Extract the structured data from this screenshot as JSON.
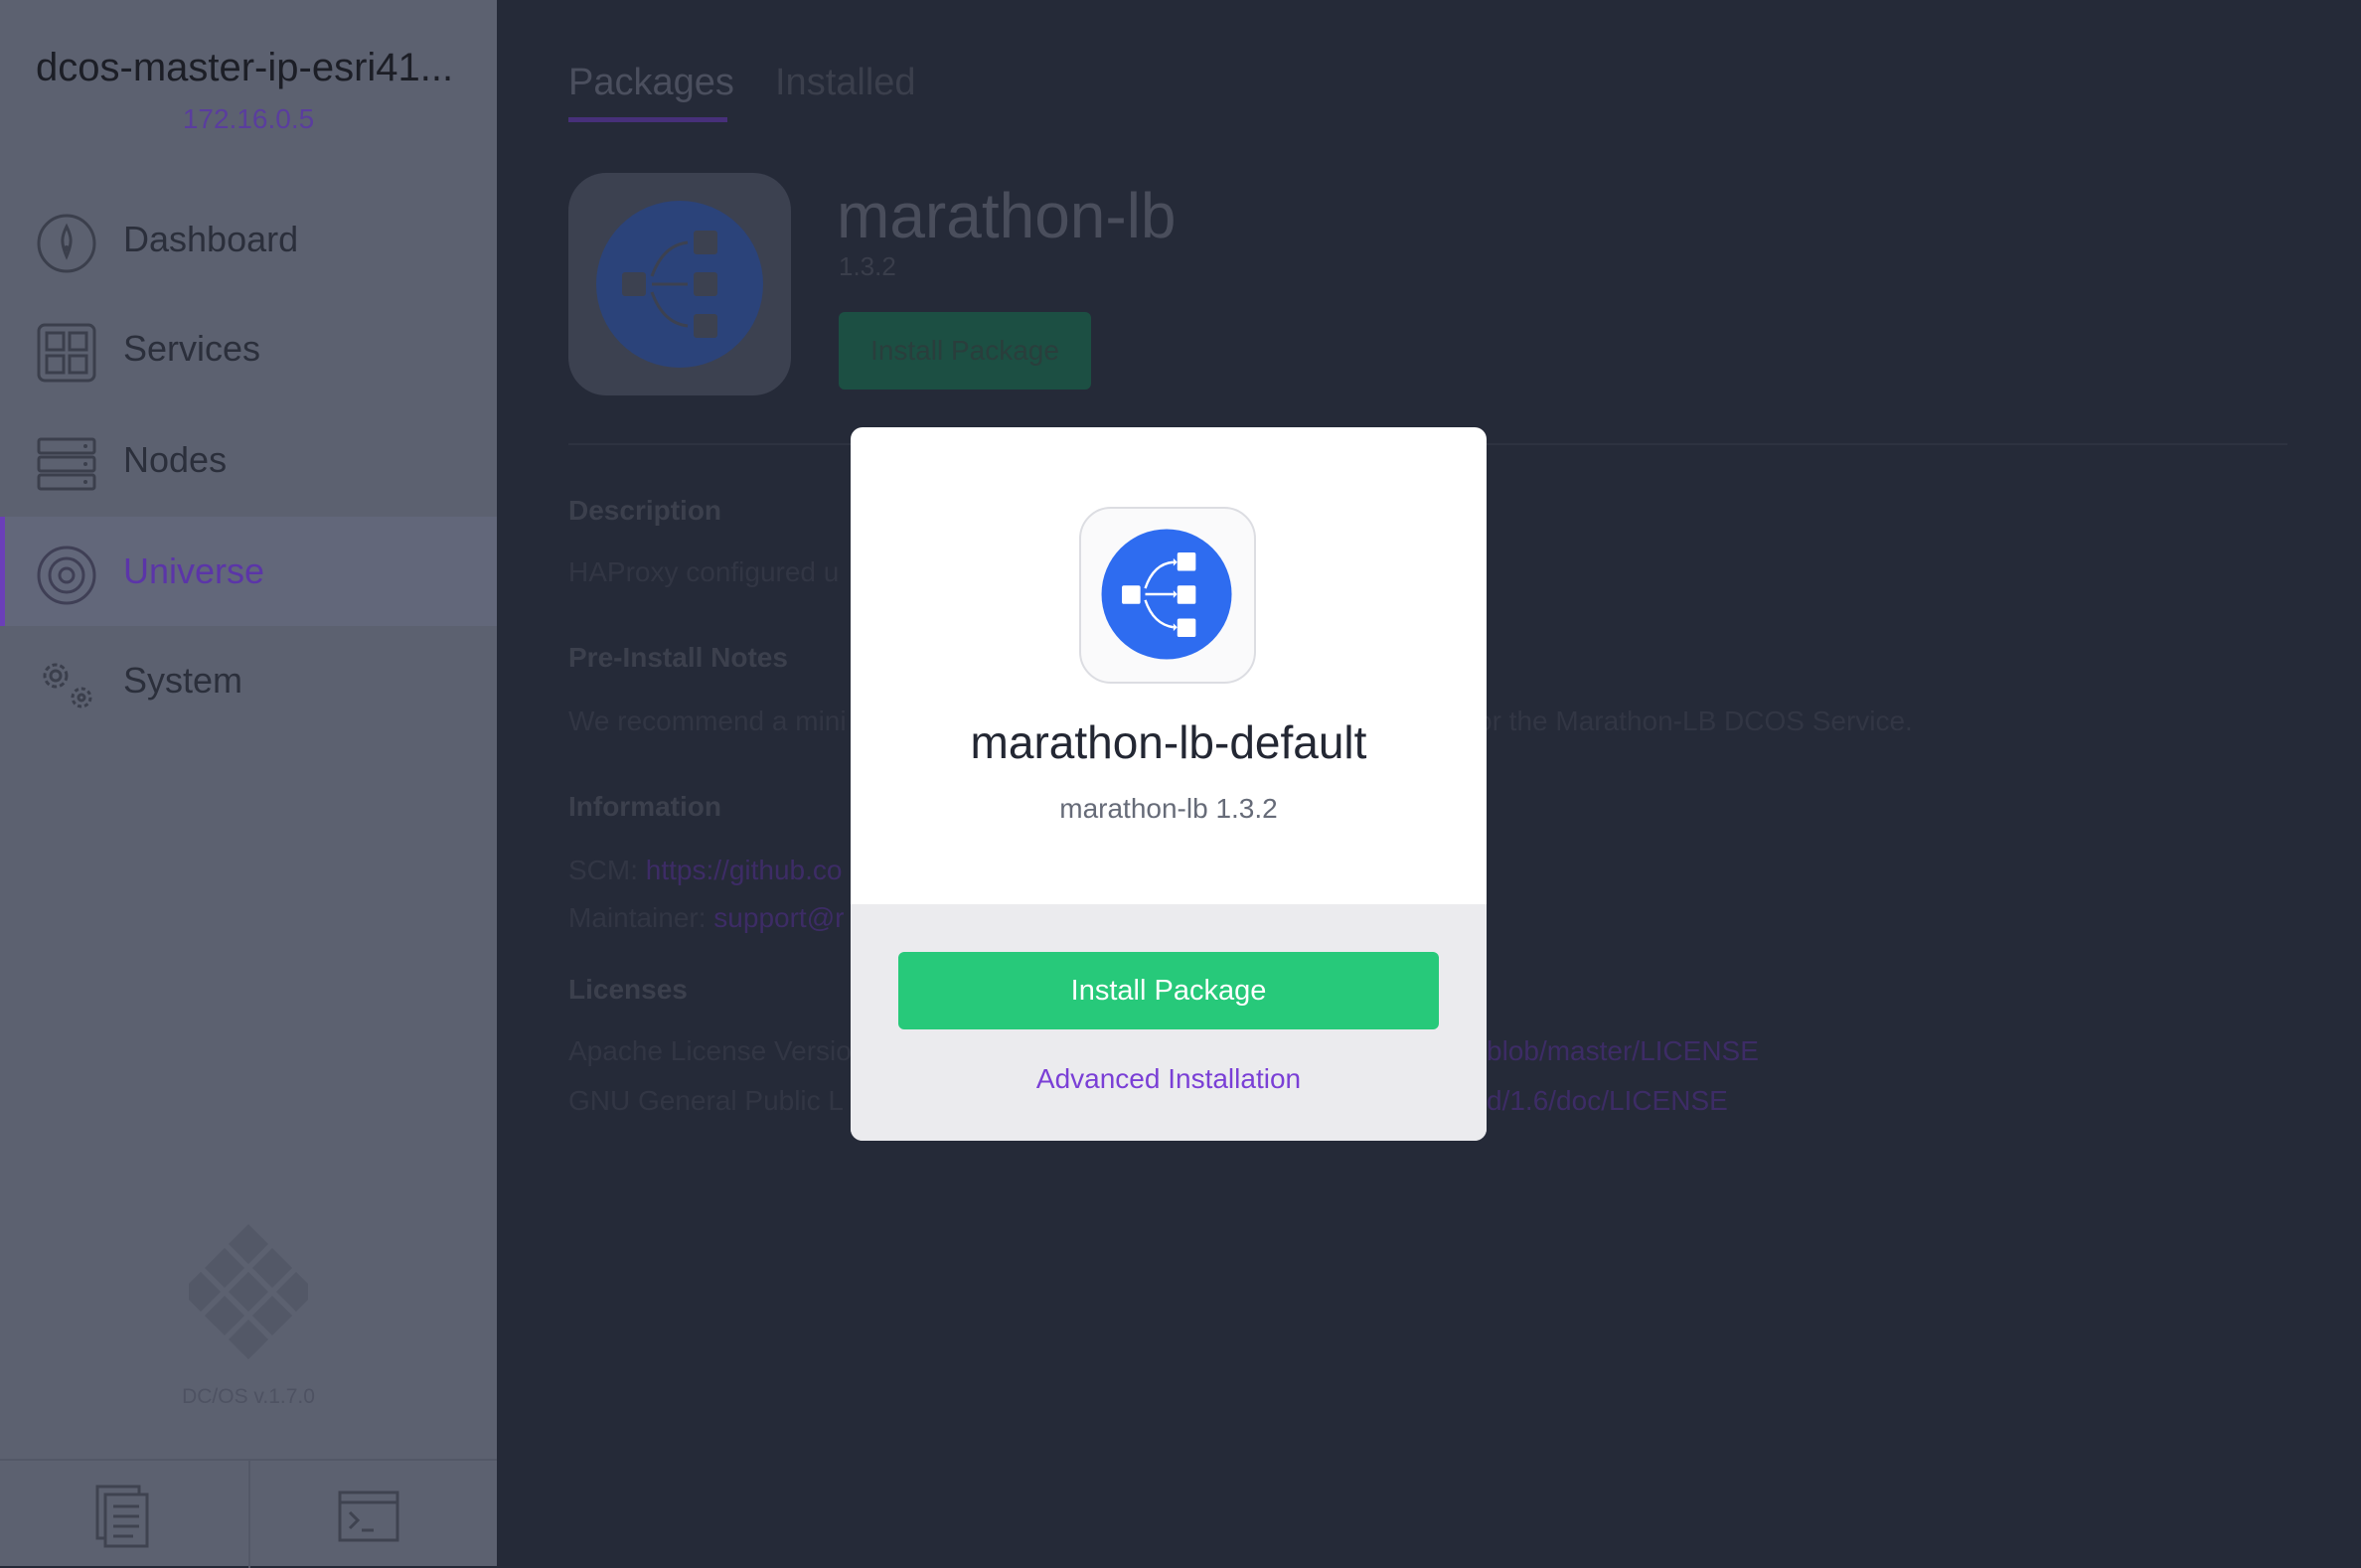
{
  "sidebar": {
    "cluster_name": "dcos-master-ip-esri41...",
    "cluster_ip": "172.16.0.5",
    "items": [
      {
        "label": "Dashboard",
        "icon": "dashboard-icon"
      },
      {
        "label": "Services",
        "icon": "services-icon"
      },
      {
        "label": "Nodes",
        "icon": "nodes-icon"
      },
      {
        "label": "Universe",
        "icon": "universe-icon",
        "active": true
      },
      {
        "label": "System",
        "icon": "system-icon"
      }
    ],
    "version": "DC/OS v.1.7.0",
    "footer": {
      "docs_icon": "documentation-icon",
      "cli_icon": "cli-terminal-icon"
    }
  },
  "tabs": [
    {
      "label": "Packages",
      "active": true
    },
    {
      "label": "Installed",
      "active": false
    }
  ],
  "package": {
    "name": "marathon-lb",
    "version": "1.3.2",
    "install_label": "Install Package"
  },
  "details": {
    "description_heading": "Description",
    "description_text": "HAProxy configured u",
    "preinstall_heading": "Pre-Install Notes",
    "preinstall_text": "We recommend a mini",
    "preinstall_text_tail": "or the Marathon-LB DCOS Service.",
    "information_heading": "Information",
    "scm_label": "SCM:",
    "scm_link": "https://github.co",
    "maintainer_label": "Maintainer:",
    "maintainer_link": "support@r",
    "licenses_heading": "Licenses",
    "license1_text": "Apache License Versio",
    "license1_link_tail": "blob/master/LICENSE",
    "license2_text": "GNU General Public L",
    "license2_link_tail": "d/1.6/doc/LICENSE"
  },
  "modal": {
    "name": "marathon-lb-default",
    "subtitle": "marathon-lb 1.3.2",
    "install_label": "Install Package",
    "advanced_label": "Advanced Installation",
    "icon": "marathon-lb-icon"
  },
  "colors": {
    "accent": "#7a3fd6",
    "install_green": "#27c97a",
    "package_blue": "#2e6cf0"
  }
}
